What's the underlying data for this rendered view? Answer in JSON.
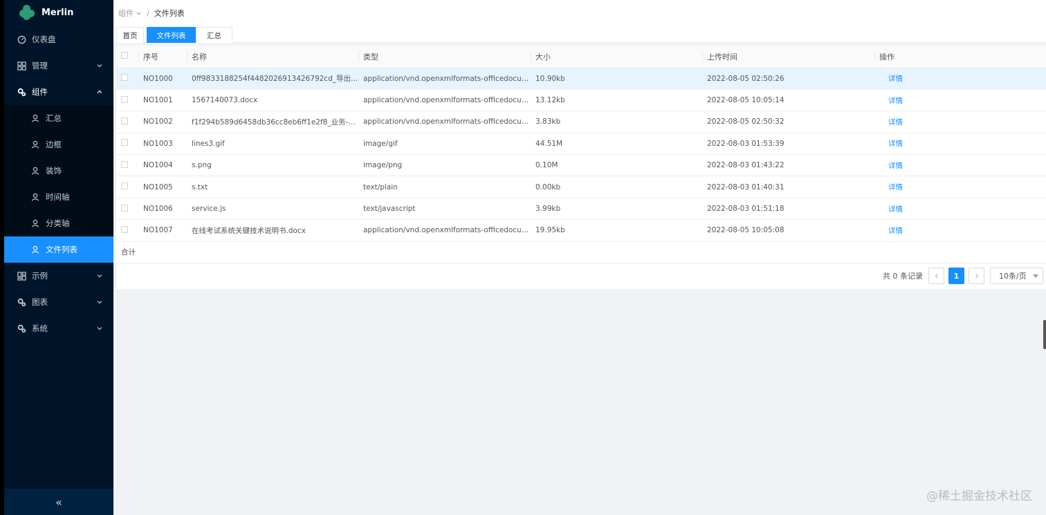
{
  "app": {
    "title": "Merlin"
  },
  "sidebar": {
    "items": [
      {
        "label": "仪表盘",
        "icon": "dashboard-icon"
      },
      {
        "label": "管理",
        "icon": "grid-icon",
        "expanded": false
      },
      {
        "label": "组件",
        "icon": "gear-icon",
        "expanded": true,
        "children": [
          "汇总",
          "边框",
          "装饰",
          "时间轴",
          "分类轴",
          "文件列表"
        ],
        "active_child": "文件列表"
      },
      {
        "label": "示例",
        "icon": "grid-icon",
        "expanded": false
      },
      {
        "label": "图表",
        "icon": "gear-icon",
        "expanded": false
      },
      {
        "label": "系统",
        "icon": "gear-icon",
        "expanded": false
      }
    ],
    "collapse_label": "«"
  },
  "breadcrumb": {
    "parent": "组件",
    "current": "文件列表"
  },
  "tabs": [
    {
      "label": "首页",
      "active": false
    },
    {
      "label": "文件列表",
      "active": true
    },
    {
      "label": "汇总",
      "active": false
    }
  ],
  "table": {
    "columns": [
      "序号",
      "名称",
      "类型",
      "大小",
      "上传时间",
      "操作"
    ],
    "rows": [
      {
        "id": "NO1000",
        "name": "0ff9833188254f4482026913426792cd_导出-施工...",
        "type": "application/vnd.openxmlformats-officedocument....",
        "size": "10.90kb",
        "time": "2022-08-05 02:50:26",
        "action": "详情"
      },
      {
        "id": "NO1001",
        "name": "1567140073.docx",
        "type": "application/vnd.openxmlformats-officedocument....",
        "size": "13.12kb",
        "time": "2022-08-05 10:05:14",
        "action": "详情"
      },
      {
        "id": "NO1002",
        "name": "f1f294b589d6458db36cc8eb6ff1e2f8_业务-租赁...",
        "type": "application/vnd.openxmlformats-officedocument....",
        "size": "3.83kb",
        "time": "2022-08-05 02:50:32",
        "action": "详情"
      },
      {
        "id": "NO1003",
        "name": "lines3.gif",
        "type": "image/gif",
        "size": "44.51M",
        "time": "2022-08-03 01:53:39",
        "action": "详情"
      },
      {
        "id": "NO1004",
        "name": "s.png",
        "type": "image/png",
        "size": "0.10M",
        "time": "2022-08-03 01:43:22",
        "action": "详情"
      },
      {
        "id": "NO1005",
        "name": "s.txt",
        "type": "text/plain",
        "size": "0.00kb",
        "time": "2022-08-03 01:40:31",
        "action": "详情"
      },
      {
        "id": "NO1006",
        "name": "service.js",
        "type": "text/javascript",
        "size": "3.99kb",
        "time": "2022-08-03 01:51:18",
        "action": "详情"
      },
      {
        "id": "NO1007",
        "name": "在线考试系统关键技术说明书.docx",
        "type": "application/vnd.openxmlformats-officedocument....",
        "size": "19.95kb",
        "time": "2022-08-05 10:05:08",
        "action": "详情"
      }
    ],
    "summary_label": "合计"
  },
  "pagination": {
    "total_text": "共 0 条记录",
    "current_page": "1",
    "page_size": "10条/页"
  },
  "watermark": "@稀土掘金技术社区",
  "colors": {
    "accent": "#1890ff",
    "sidebar_bg": "#001529",
    "sub_bg": "#000c17"
  }
}
